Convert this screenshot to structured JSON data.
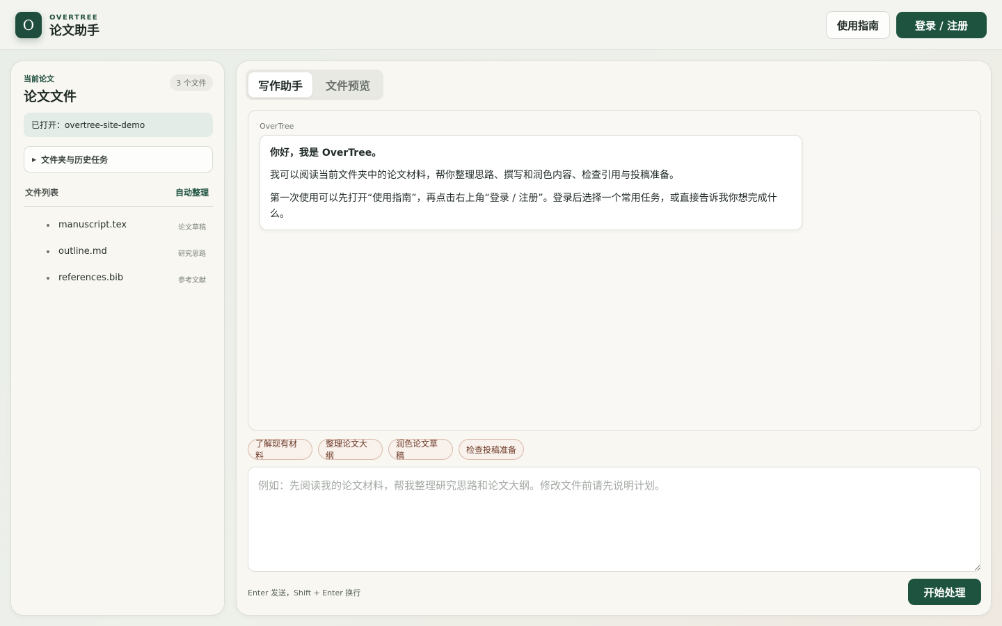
{
  "header": {
    "logo_letter": "O",
    "brand_small": "OVERTREE",
    "brand_name": "论文助手",
    "guide_label": "使用指南",
    "login_label": "登录 / 注册"
  },
  "sidebar": {
    "label": "当前论文",
    "title": "论文文件",
    "file_count": "3 个文件",
    "opened": "已打开：overtree-site-demo",
    "folder_toggle": "文件夹与历史任务",
    "list_header": "文件列表",
    "auto_organize": "自动整理",
    "files": [
      {
        "name": "manuscript.tex",
        "tag": "论文草稿"
      },
      {
        "name": "outline.md",
        "tag": "研究思路"
      },
      {
        "name": "references.bib",
        "tag": "参考文献"
      }
    ]
  },
  "main": {
    "tabs": [
      {
        "label": "写作助手",
        "active": true
      },
      {
        "label": "文件预览",
        "active": false
      }
    ],
    "chat": {
      "sender": "OverTree",
      "greeting": "你好，我是 OverTree。",
      "line2": "我可以阅读当前文件夹中的论文材料，帮你整理思路、撰写和润色内容、检查引用与投稿准备。",
      "line3": "第一次使用可以先打开“使用指南”，再点击右上角“登录 / 注册”。登录后选择一个常用任务，或直接告诉我你想完成什么。"
    },
    "chips": [
      "了解现有材料",
      "整理论文大纲",
      "润色论文草稿",
      "检查投稿准备"
    ],
    "input_placeholder": "例如：先阅读我的论文材料，帮我整理研究思路和论文大纲。修改文件前请先说明计划。",
    "hint": "Enter 发送，Shift + Enter 换行",
    "start_label": "开始处理"
  },
  "colors": {
    "accent": "#1e5340",
    "chip_border": "#d9b8a7",
    "chip_text": "#6e3a26"
  }
}
